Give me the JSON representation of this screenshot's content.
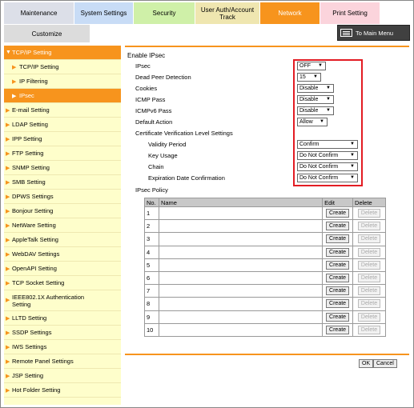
{
  "tabs": {
    "maintenance": "Maintenance",
    "system": "System Settings",
    "security": "Security",
    "user_auth": "User Auth/Account Track",
    "network": "Network",
    "print": "Print Setting"
  },
  "subtab": "Customize",
  "main_menu": "To Main Menu",
  "sidebar": {
    "tcpip": "TCP/IP Setting",
    "tcpip_sub": "TCP/IP Setting",
    "ip_filtering": "IP Filtering",
    "ipsec": "IPsec",
    "items": [
      "E-mail Setting",
      "LDAP Setting",
      "IPP Setting",
      "FTP Setting",
      "SNMP Setting",
      "SMB Setting",
      "DPWS Settings",
      "Bonjour Setting",
      "NetWare Setting",
      "AppleTalk Setting",
      "WebDAV Settings",
      "OpenAPI Setting",
      "TCP Socket Setting"
    ],
    "ieee": "IEEE802.1X Authentication Setting",
    "items2": [
      "LLTD Setting",
      "SSDP Settings",
      "IWS Settings",
      "Remote Panel Settings",
      "JSP Setting",
      "Hot Folder Setting"
    ]
  },
  "form": {
    "heading": "Enable IPsec",
    "ipsec_label": "IPsec",
    "ipsec_value": "OFF",
    "dpd_label": "Dead Peer Detection",
    "dpd_value": "15",
    "cookies_label": "Cookies",
    "cookies_value": "Disable",
    "icmp_label": "ICMP Pass",
    "icmp_value": "Disable",
    "icmpv6_label": "ICMPv6 Pass",
    "icmpv6_value": "Disable",
    "default_action_label": "Default Action",
    "default_action_value": "Allow",
    "cert_label": "Certificate Verification Level Settings",
    "validity_label": "Validity Period",
    "validity_value": "Confirm",
    "key_usage_label": "Key Usage",
    "key_usage_value": "Do Not Confirm",
    "chain_label": "Chain",
    "chain_value": "Do Not Confirm",
    "expiration_label": "Expiration Date Confirmation",
    "expiration_value": "Do Not Confirm"
  },
  "policy": {
    "label": "IPsec Policy",
    "headers": [
      "No.",
      "Name",
      "Edit",
      "Delete"
    ],
    "rows": [
      "1",
      "2",
      "3",
      "4",
      "5",
      "6",
      "7",
      "8",
      "9",
      "10"
    ],
    "create": "Create",
    "delete": "Delete"
  },
  "buttons": {
    "ok": "OK",
    "cancel": "Cancel"
  }
}
